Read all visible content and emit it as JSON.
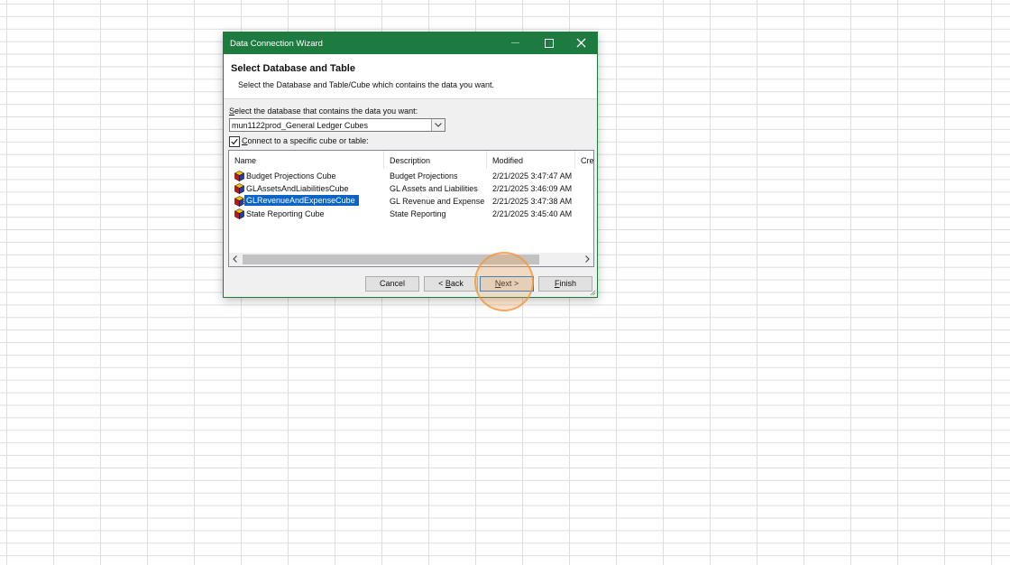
{
  "dialog": {
    "title": "Data Connection Wizard",
    "header_title": "Select Database and Table",
    "header_subtitle": "Select the Database and Table/Cube which contains the data you want.",
    "db_label_mnemonic": "S",
    "db_label_rest": "elect the database that contains the data you want:",
    "db_value": "mun1122prod_General Ledger Cubes",
    "connect_checkbox": {
      "checked": true,
      "mnemonic": "C",
      "label_rest": "onnect to a specific cube or table:"
    },
    "columns": [
      "Name",
      "Description",
      "Modified",
      "Cre"
    ],
    "rows": [
      {
        "name": "Budget Projections Cube",
        "description": "Budget Projections",
        "modified": "2/21/2025 3:47:47 AM",
        "selected": false
      },
      {
        "name": "GLAssetsAndLiabilitiesCube",
        "description": "GL Assets and Liabilities",
        "modified": "2/21/2025 3:46:09 AM",
        "selected": false
      },
      {
        "name": "GLRevenueAndExpenseCube",
        "description": "GL Revenue and Expense",
        "modified": "2/21/2025 3:47:38 AM",
        "selected": true
      },
      {
        "name": "State Reporting Cube",
        "description": "State Reporting",
        "modified": "2/21/2025 3:45:40 AM",
        "selected": false
      }
    ],
    "buttons": {
      "cancel": "Cancel",
      "back_pre": "< ",
      "back_mnemonic": "B",
      "back_rest": "ack",
      "next_mnemonic": "N",
      "next_rest": "ext >",
      "finish_mnemonic": "F",
      "finish_rest": "inish"
    }
  },
  "colors": {
    "titlebar": "#1e7b3f",
    "selection": "#0a64c8",
    "highlight": "#f5a050"
  },
  "icons": {
    "cube": "cube-icon",
    "close": "close-icon",
    "maximize": "maximize-icon",
    "minimize": "minimize-icon",
    "dropdown": "chevron-down-icon"
  }
}
